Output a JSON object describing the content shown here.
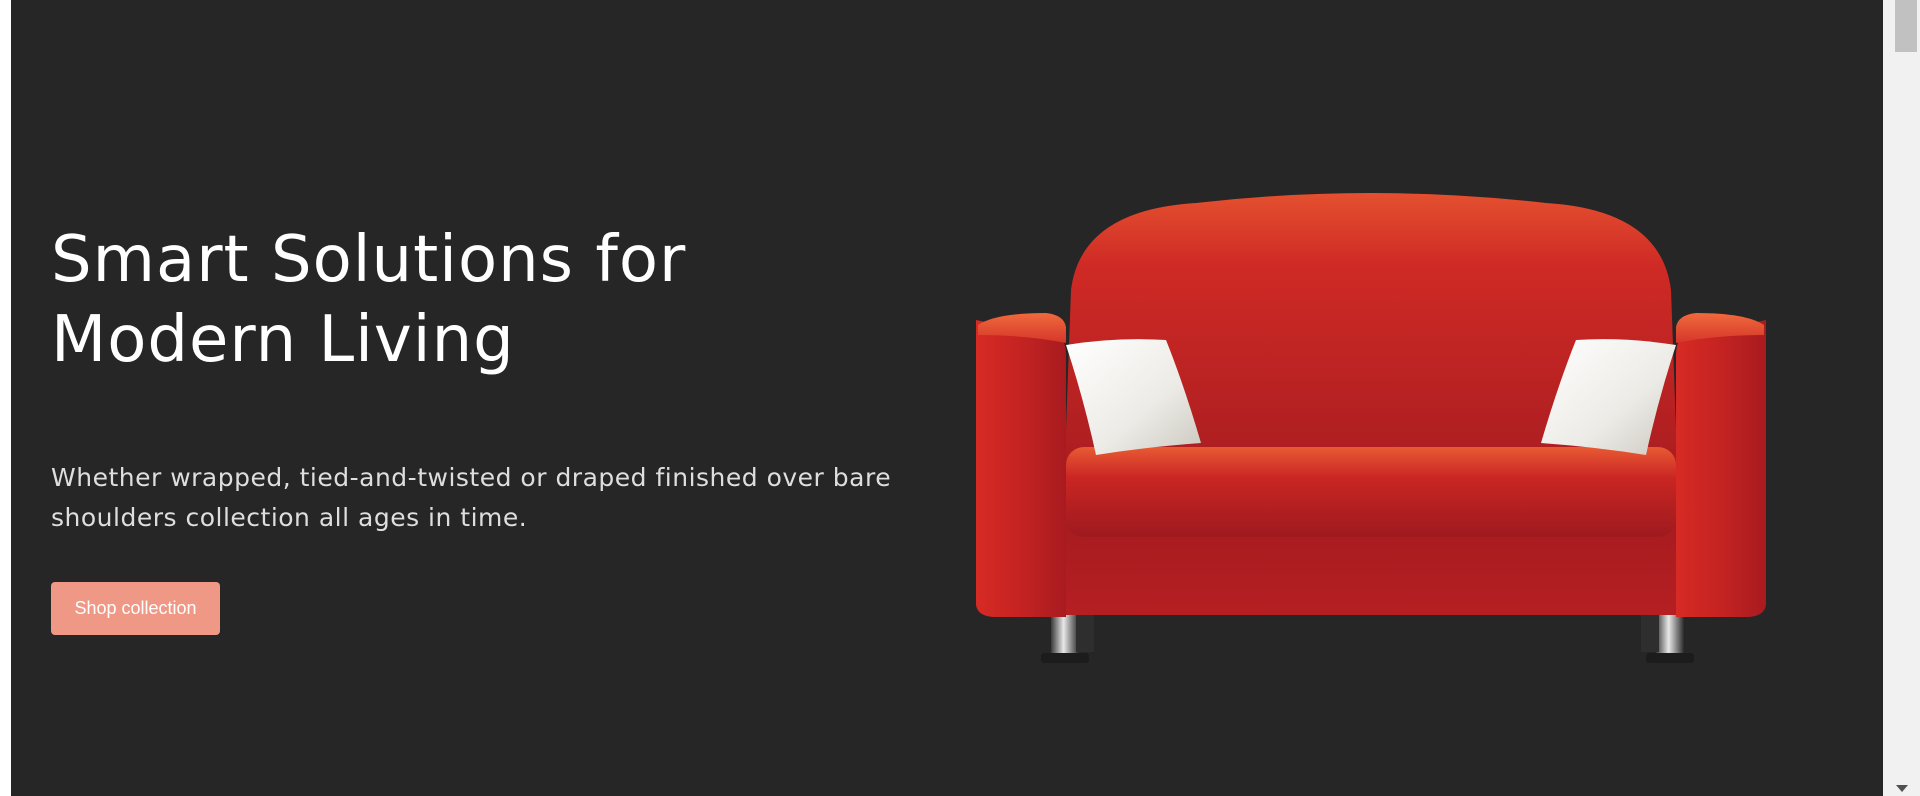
{
  "hero": {
    "title_line1": "Smart Solutions for",
    "title_line2": "Modern Living",
    "subtitle": "Whether wrapped, tied-and-twisted or draped finished over bare shoulders collection all ages in time.",
    "button_label": "Shop collection",
    "background_color": "#262626",
    "button_color": "#f09886",
    "image": "red-sofa-with-white-pillows"
  },
  "scrollbar": {
    "thumb_color": "#c1c1c1",
    "track_color": "#f1f1f1"
  }
}
